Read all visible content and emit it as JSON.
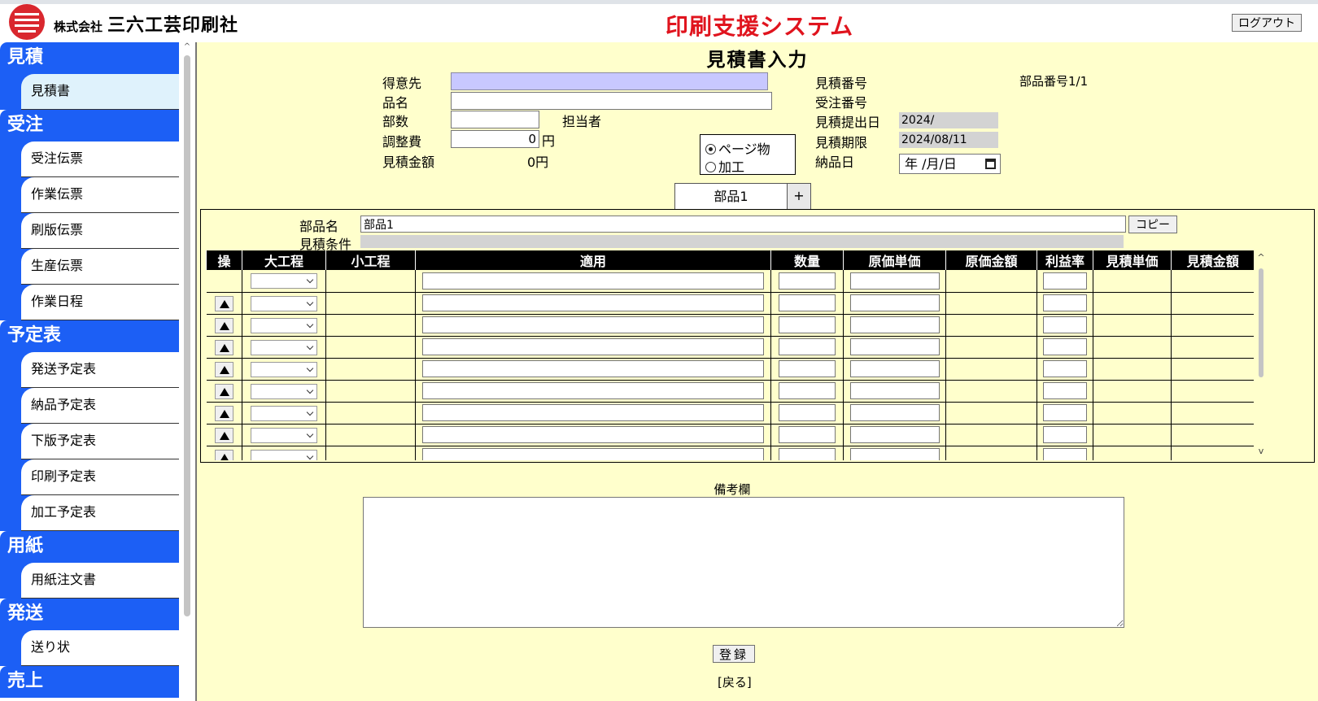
{
  "header": {
    "company_small": "株式会社",
    "company_name": "三六工芸印刷社",
    "app_title": "印刷支援システム",
    "logout_label": "ログアウト"
  },
  "sidebar": {
    "sections": [
      {
        "title": "見積",
        "items": [
          "見積書"
        ]
      },
      {
        "title": "受注",
        "items": [
          "受注伝票",
          "作業伝票",
          "刷版伝票",
          "生産伝票",
          "作業日程"
        ]
      },
      {
        "title": "予定表",
        "items": [
          "発送予定表",
          "納品予定表",
          "下版予定表",
          "印刷予定表",
          "加工予定表"
        ]
      },
      {
        "title": "用紙",
        "items": [
          "用紙注文書"
        ]
      },
      {
        "title": "発送",
        "items": [
          "送り状"
        ]
      },
      {
        "title": "売上",
        "items": []
      }
    ],
    "active_item": "見積書"
  },
  "form": {
    "page_title": "見積書入力",
    "customer_label": "得意先",
    "customer_value": "",
    "product_label": "品名",
    "product_value": "",
    "copies_label": "部数",
    "copies_value": "",
    "person_label": "担当者",
    "adjust_label": "調整費",
    "adjust_value": "0",
    "yen": "円",
    "amount_label": "見積金額",
    "amount_value": "0円",
    "type_options": [
      "ページ物",
      "加工"
    ],
    "type_selected": "ページ物",
    "quote_no_label": "見積番号",
    "part_no_text": "部品番号1/1",
    "order_no_label": "受注番号",
    "submit_date_label": "見積提出日",
    "submit_date_value": "2024/",
    "expiry_label": "見積期限",
    "expiry_value": "2024/08/11",
    "delivery_label": "納品日",
    "delivery_placeholder": "年 /月/日"
  },
  "part_tab": {
    "name": "部品1",
    "add_label": "+"
  },
  "part": {
    "name_label": "部品名",
    "name_value": "部品1",
    "copy_label": "コピー",
    "conditions_label": "見積条件",
    "columns": [
      "操",
      "大工程",
      "小工程",
      "適用",
      "数量",
      "原価単価",
      "原価金額",
      "利益率",
      "見積単価",
      "見積金額"
    ],
    "row_count": 9
  },
  "remarks": {
    "label": "備考欄",
    "value": ""
  },
  "submit_label": "登録",
  "bottom_link": "[戻る]"
}
